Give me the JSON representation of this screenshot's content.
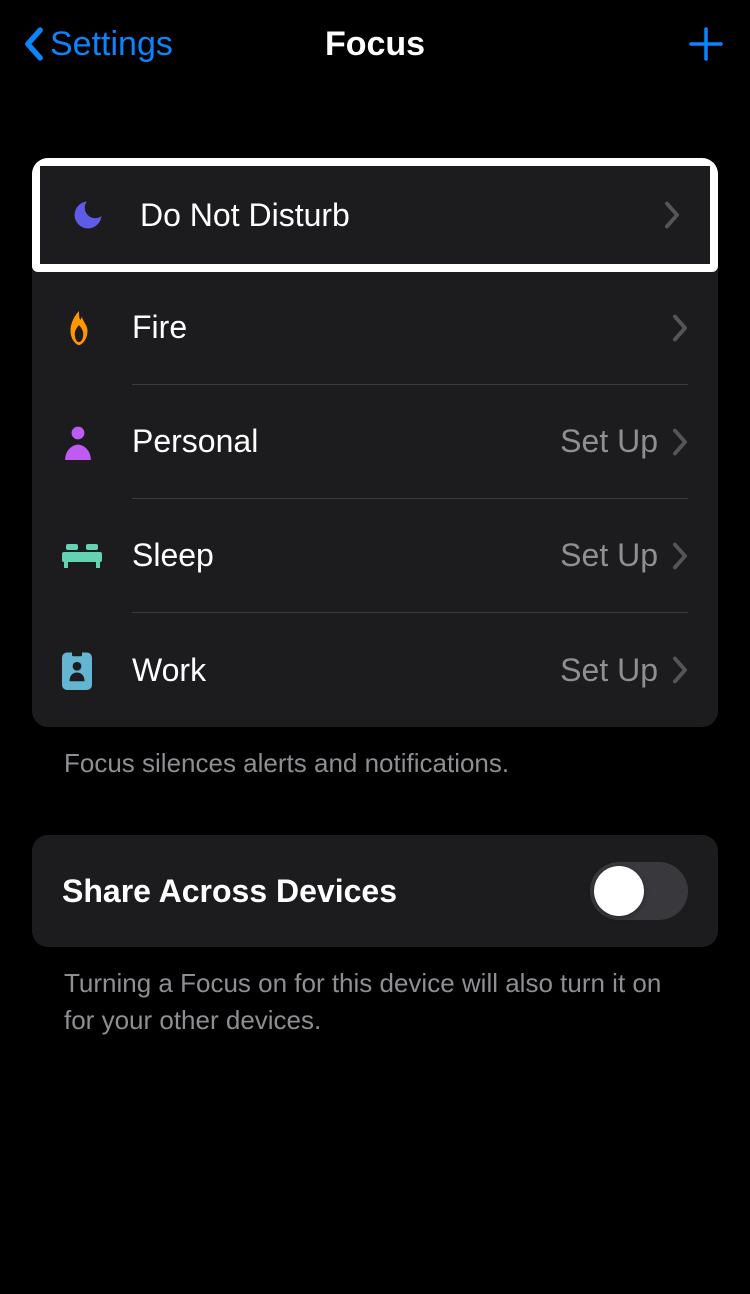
{
  "header": {
    "back_label": "Settings",
    "title": "Focus"
  },
  "focus_list": {
    "items": [
      {
        "label": "Do Not Disturb",
        "trailing": "",
        "icon": "moon"
      },
      {
        "label": "Fire",
        "trailing": "",
        "icon": "fire"
      },
      {
        "label": "Personal",
        "trailing": "Set Up",
        "icon": "person"
      },
      {
        "label": "Sleep",
        "trailing": "Set Up",
        "icon": "bed"
      },
      {
        "label": "Work",
        "trailing": "Set Up",
        "icon": "badge"
      }
    ],
    "footer": "Focus silences alerts and notifications."
  },
  "share": {
    "label": "Share Across Devices",
    "footer": "Turning a Focus on for this device will also turn it on for your other devices.",
    "enabled": false
  }
}
